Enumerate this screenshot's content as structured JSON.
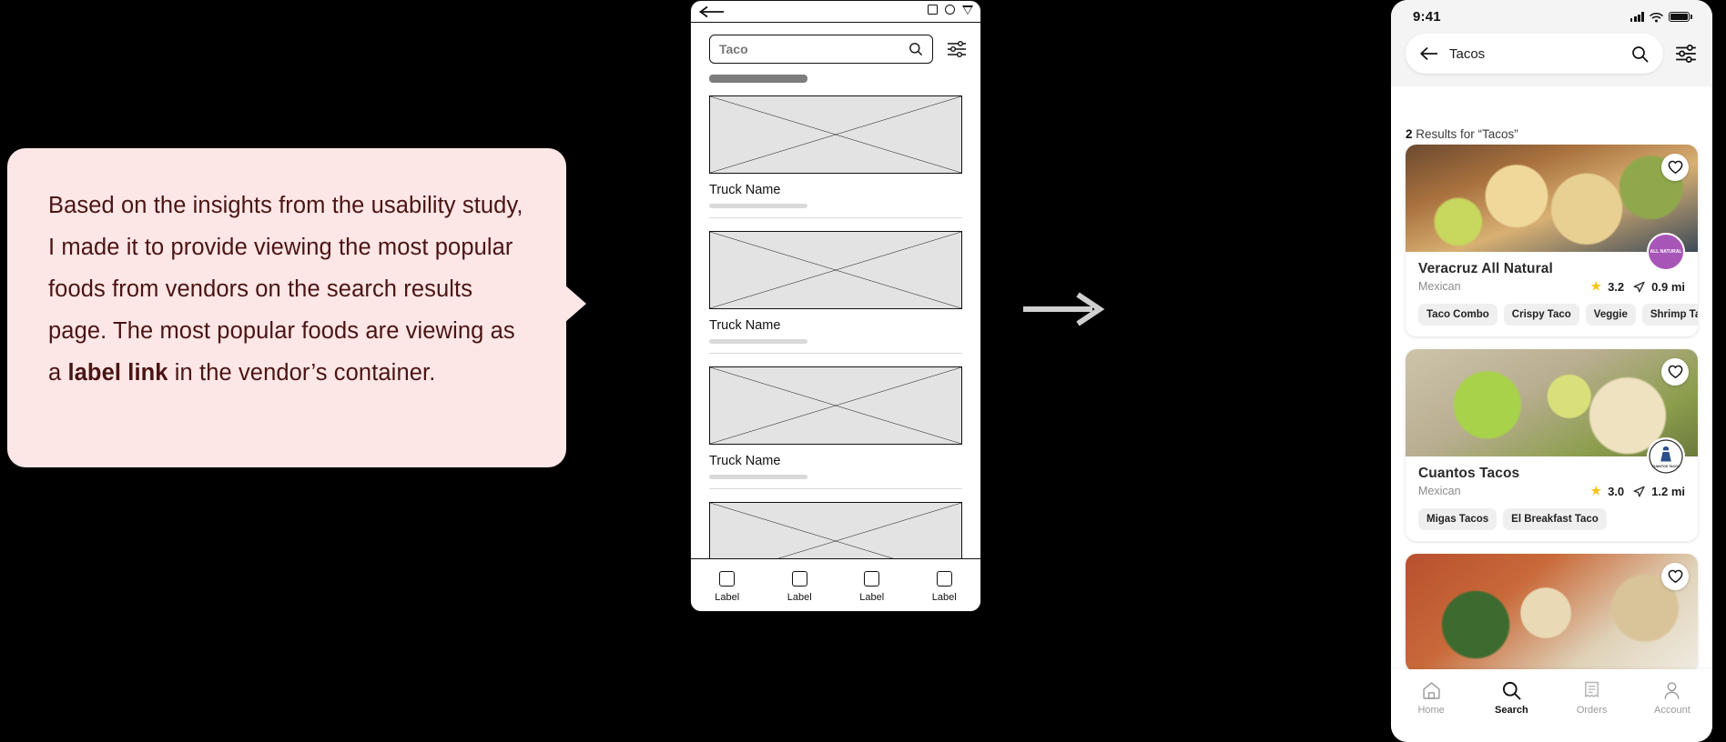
{
  "callout": {
    "text_parts": [
      "Based on the insights from the usability study, I made it to provide viewing the most popular foods from vendors on the search results page. The most popular foods are viewing as a ",
      "label link",
      " in the vendor’s container."
    ],
    "background_color": "#FDE7E6",
    "text_color": "#4A1414"
  },
  "flow_arrow": {
    "name": "rightwards-arrow",
    "color": "#CFCFCF"
  },
  "wireframe": {
    "window_icons": [
      "square",
      "circle",
      "triangle-down"
    ],
    "back_icon": "arrow-left",
    "search": {
      "value": "Taco",
      "icon": "search-icon"
    },
    "filter_icon": "sliders-icon",
    "items": [
      {
        "name": "Truck Name"
      },
      {
        "name": "Truck Name"
      },
      {
        "name": "Truck Name"
      },
      {
        "name": ""
      }
    ],
    "tabs": [
      {
        "label": "Label"
      },
      {
        "label": "Label"
      },
      {
        "label": "Label"
      },
      {
        "label": "Label"
      }
    ]
  },
  "hifi": {
    "status": {
      "time": "9:41",
      "signal_icon": "cellular-bars-icon",
      "wifi_icon": "wifi-icon",
      "battery_icon": "battery-full-icon"
    },
    "header": {
      "back_icon": "arrow-left",
      "search_value": "Tacos",
      "search_icon": "search-icon",
      "filter_icon": "sliders-icon"
    },
    "results_count": "2",
    "results_text": " Results for “Tacos”",
    "cards": [
      {
        "title": "Veracruz All Natural",
        "cuisine": "Mexican",
        "rating": "3.2",
        "distance": "0.9 mi",
        "chips": [
          "Taco Combo",
          "Crispy Taco",
          "Veggie",
          "Shrimp Taco"
        ],
        "favorite_icon": "heart-outline-icon",
        "logo_name": "veracruz-all-natural-logo",
        "logo_text": "ALL NATURAL",
        "logo_color": "#A855B8"
      },
      {
        "title": "Cuantos Tacos",
        "cuisine": "Mexican",
        "rating": "3.0",
        "distance": "1.2 mi",
        "chips": [
          "Migas Tacos",
          "El Breakfast Taco"
        ],
        "favorite_icon": "heart-outline-icon",
        "logo_name": "cuantos-tacos-logo",
        "logo_text": "CUANTOS TACOS",
        "logo_color": "#FFFFFF"
      },
      {
        "title": "",
        "cuisine": "",
        "rating": "",
        "distance": "",
        "chips": [],
        "favorite_icon": "heart-outline-icon",
        "logo_name": "",
        "logo_text": "",
        "logo_color": "#FFFFFF"
      }
    ],
    "tabs": [
      {
        "label": "Home",
        "icon": "home-icon",
        "active": false
      },
      {
        "label": "Search",
        "icon": "search-icon",
        "active": true
      },
      {
        "label": "Orders",
        "icon": "receipt-icon",
        "active": false
      },
      {
        "label": "Account",
        "icon": "person-icon",
        "active": false
      }
    ]
  }
}
